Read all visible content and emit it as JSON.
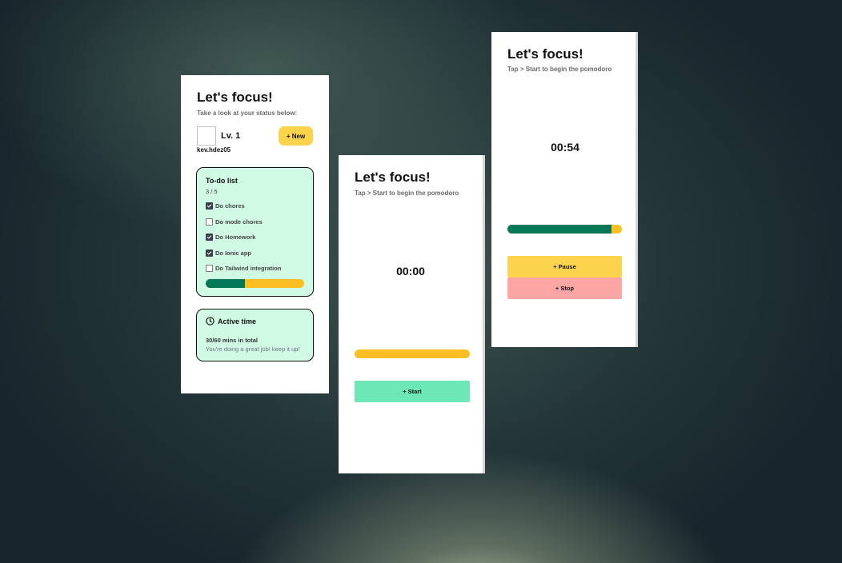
{
  "panel1": {
    "title": "Let's focus!",
    "subtitle": "Take a look at your status below:",
    "level": "Lv. 1",
    "username": "kev.hdez05",
    "new_button": "+ New",
    "todo": {
      "title": "To-do list",
      "count": "3 / 5",
      "items": [
        {
          "label": "Do chores",
          "checked": true
        },
        {
          "label": "Do mode chores",
          "checked": false
        },
        {
          "label": "Do Homework",
          "checked": true
        },
        {
          "label": "Do Ionic app",
          "checked": true
        },
        {
          "label": "Do Tailwind integration",
          "checked": false
        }
      ],
      "progress": 0.4
    },
    "active_time": {
      "title": "Active time",
      "total": "30/60 mins in total",
      "message": "You're doing a great job! keep it up!",
      "icon": "clock-icon"
    }
  },
  "panel2": {
    "title": "Let's focus!",
    "subtitle": "Tap > Start to begin the pomodoro",
    "timer": "00:00",
    "progress": 0,
    "start_button": "+ Start"
  },
  "panel3": {
    "title": "Let's focus!",
    "subtitle": "Tap > Start to begin the pomodoro",
    "timer": "00:54",
    "progress": 0.91,
    "pause_button": "+ Pause",
    "stop_button": "+ Stop"
  },
  "colors": {
    "accent_yellow": "#fcd34d",
    "progress_yellow": "#fbbf24",
    "progress_green": "#047857",
    "card_green": "#d1fae5",
    "start_green": "#6ee7b7",
    "stop_red": "#fca5a5"
  }
}
